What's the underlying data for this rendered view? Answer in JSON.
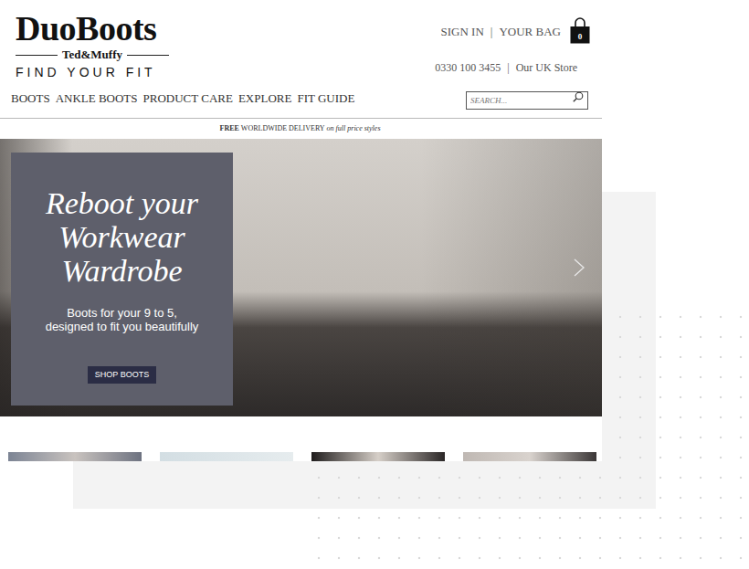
{
  "logo": {
    "brand": "DuoBoots",
    "sub_brand": "Ted&Muffy",
    "tagline": "FIND YOUR FIT"
  },
  "account": {
    "sign_in": "SIGN IN",
    "separator": "|",
    "bag": "YOUR BAG",
    "bag_count": "0"
  },
  "contact": {
    "phone": "0330 100 3455",
    "separator": "|",
    "store": "Our UK Store"
  },
  "nav": [
    {
      "label": "BOOTS"
    },
    {
      "label": "ANKLE BOOTS"
    },
    {
      "label": "PRODUCT CARE"
    },
    {
      "label": "EXPLORE"
    },
    {
      "label": "FIT GUIDE"
    }
  ],
  "search": {
    "placeholder": "SEARCH..."
  },
  "promo": {
    "bold": "FREE",
    "text": "WORLDWIDE DELIVERY",
    "note": "on full price styles"
  },
  "hero": {
    "title": [
      "Reboot your",
      "Workwear",
      "Wardrobe"
    ],
    "subtitle": [
      "Boots for your 9 to 5,",
      "designed to fit you beautifully"
    ],
    "button": "SHOP BOOTS"
  }
}
